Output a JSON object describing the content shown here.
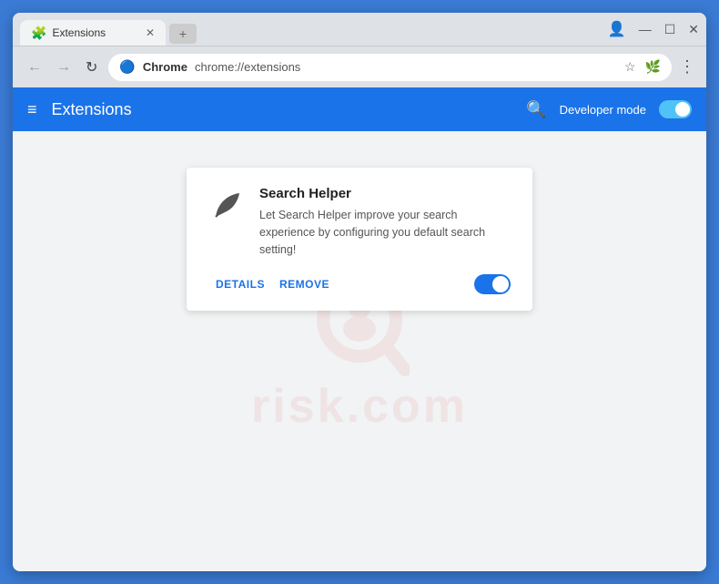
{
  "window": {
    "title": "Extensions",
    "tab_label": "Extensions",
    "url_chrome": "Chrome",
    "url_full": "chrome://extensions",
    "controls": {
      "minimize": "—",
      "maximize": "☐",
      "close": "✕"
    }
  },
  "nav": {
    "back": "←",
    "forward": "→",
    "reload": "↻"
  },
  "header": {
    "menu_icon": "≡",
    "title": "Extensions",
    "search_icon": "🔍",
    "dev_mode_label": "Developer mode"
  },
  "extension": {
    "name": "Search Helper",
    "description": "Let Search Helper improve your search experience by configuring you default search setting!",
    "details_btn": "DETAILS",
    "remove_btn": "REMOVE",
    "enabled": true
  },
  "watermark": {
    "text": "risk.com"
  }
}
